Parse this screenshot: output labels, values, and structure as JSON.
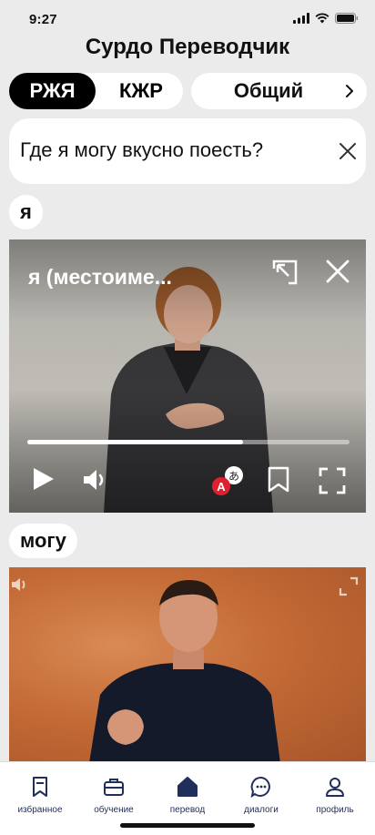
{
  "status_bar": {
    "time": "9:27"
  },
  "app": {
    "title": "Сурдо Переводчик"
  },
  "language_toggle": {
    "active": "РЖЯ",
    "inactive": "КЖР"
  },
  "category": {
    "label": "Общий"
  },
  "query": {
    "text": "Где я могу вкусно поесть?"
  },
  "words": [
    {
      "label": "я",
      "video_title": "я (местоиме...",
      "progress": 0.67
    },
    {
      "label": "могу"
    }
  ],
  "nav": {
    "items": [
      {
        "label": "избранное",
        "icon": "bookmark-icon"
      },
      {
        "label": "обучение",
        "icon": "briefcase-icon"
      },
      {
        "label": "перевод",
        "icon": "home-icon",
        "active": true
      },
      {
        "label": "диалоги",
        "icon": "chat-icon"
      },
      {
        "label": "профиль",
        "icon": "user-icon"
      }
    ]
  },
  "colors": {
    "accent": "#1f2f5a",
    "badge_red": "#e0202e",
    "background": "#ebebeb"
  }
}
